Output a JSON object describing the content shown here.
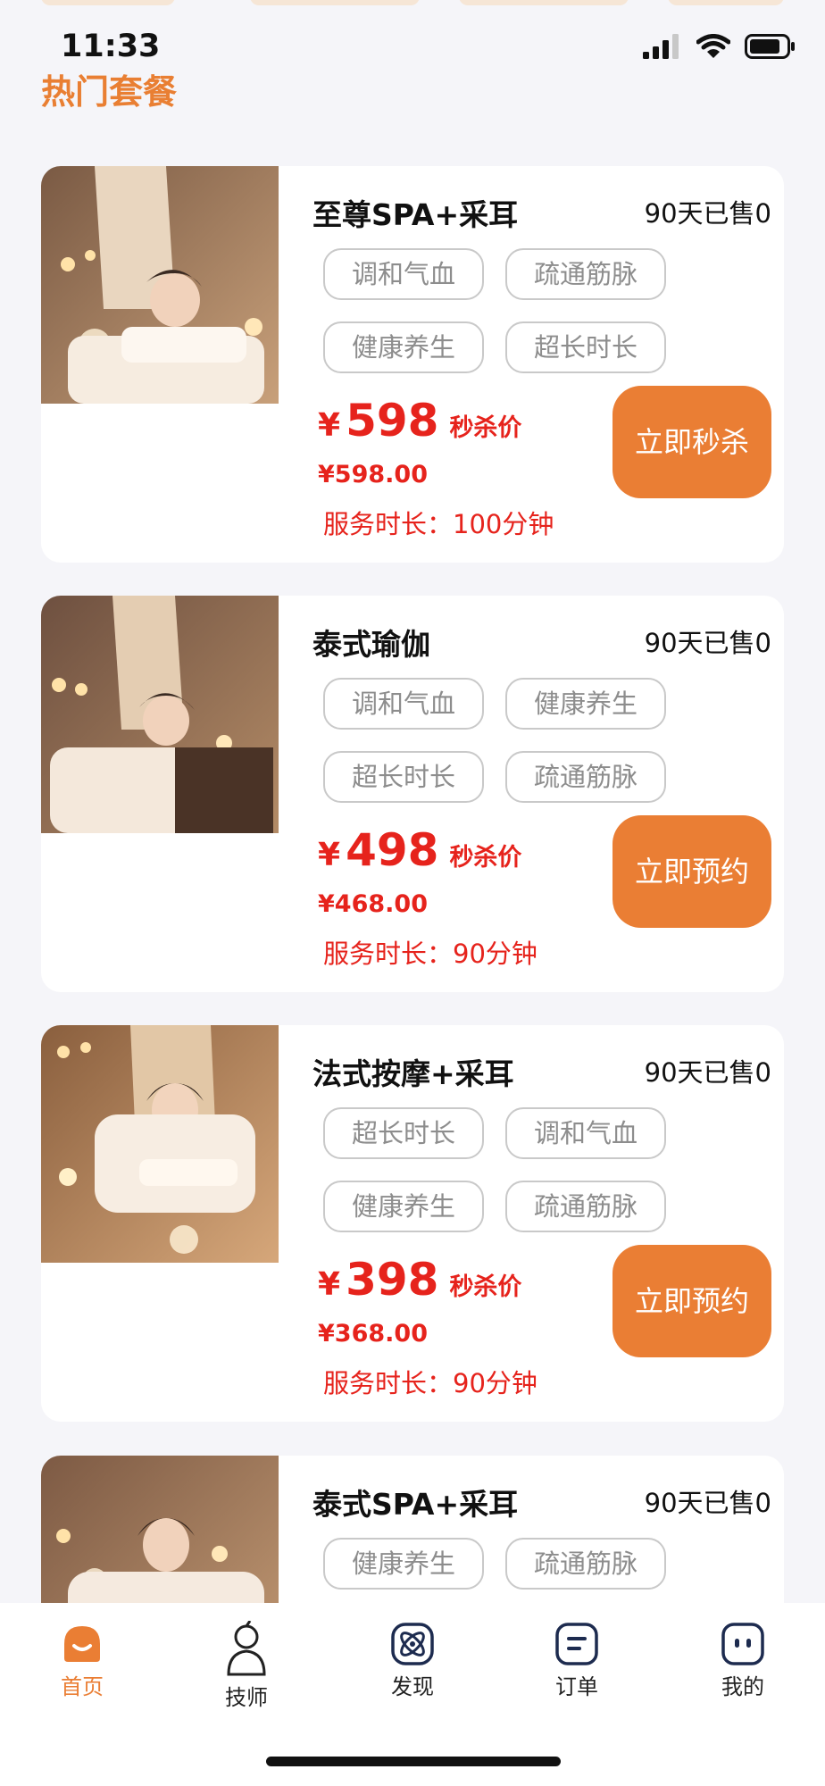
{
  "status_bar": {
    "time": "11:33"
  },
  "section": {
    "title": "热门套餐"
  },
  "packages": [
    {
      "title": "至尊SPA+采耳",
      "sold": "90天已售0",
      "tags": [
        "调和气血",
        "疏通筋脉",
        "健康养生",
        "超长时长"
      ],
      "currency": "¥",
      "price": "598",
      "price_label": "秒杀价",
      "original_price": "¥598.00",
      "duration": "服务时长：100分钟",
      "button": "立即秒杀"
    },
    {
      "title": "泰式瑜伽",
      "sold": "90天已售0",
      "tags": [
        "调和气血",
        "健康养生",
        "超长时长",
        "疏通筋脉"
      ],
      "currency": "¥",
      "price": "498",
      "price_label": "秒杀价",
      "original_price": "¥468.00",
      "duration": "服务时长：90分钟",
      "button": "立即预约"
    },
    {
      "title": "法式按摩+采耳",
      "sold": "90天已售0",
      "tags": [
        "超长时长",
        "调和气血",
        "健康养生",
        "疏通筋脉"
      ],
      "currency": "¥",
      "price": "398",
      "price_label": "秒杀价",
      "original_price": "¥368.00",
      "duration": "服务时长：90分钟",
      "button": "立即预约"
    },
    {
      "title": "泰式SPA+采耳",
      "sold": "90天已售0",
      "tags": [
        "健康养生",
        "疏通筋脉"
      ]
    }
  ],
  "nav": {
    "items": [
      {
        "label": "首页",
        "icon": "home-icon",
        "active": true
      },
      {
        "label": "技师",
        "icon": "technician-icon"
      },
      {
        "label": "发现",
        "icon": "discover-icon"
      },
      {
        "label": "订单",
        "icon": "orders-icon"
      },
      {
        "label": "我的",
        "icon": "profile-icon"
      }
    ]
  },
  "colors": {
    "accent": "#ea7e34",
    "price": "#e6231c",
    "title_orange": "#e97f33"
  }
}
